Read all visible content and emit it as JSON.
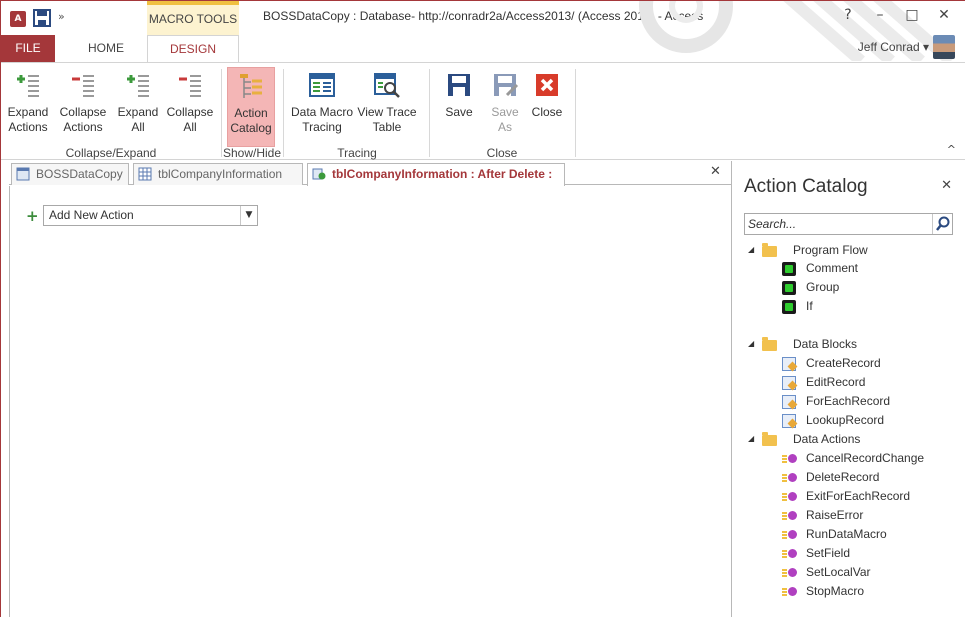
{
  "app": {
    "app_icon_letters": "A",
    "context_tab": "MACRO TOOLS",
    "window_title": "BOSSDataCopy : Database- http://conradr2a/Access2013/ (Access 2013) - Access",
    "window_controls": [
      "?",
      "–",
      "□",
      "✕"
    ],
    "user_name": "Jeff Conrad",
    "user_caret": "▾",
    "qat_more": "»"
  },
  "ribbon_tabs": {
    "file": "FILE",
    "home": "HOME",
    "design": "DESIGN"
  },
  "ribbon": {
    "groups": {
      "collapse_expand": "Collapse/Expand",
      "show_hide": "Show/Hide",
      "tracing": "Tracing",
      "close": "Close"
    },
    "buttons": {
      "expand_actions_1": "Expand",
      "expand_actions_2": "Actions",
      "collapse_actions_1": "Collapse",
      "collapse_actions_2": "Actions",
      "expand_all_1": "Expand",
      "expand_all_2": "All",
      "collapse_all_1": "Collapse",
      "collapse_all_2": "All",
      "action_catalog_1": "Action",
      "action_catalog_2": "Catalog",
      "data_macro_tracing_1": "Data Macro",
      "data_macro_tracing_2": "Tracing",
      "view_trace_table_1": "View Trace",
      "view_trace_table_2": "Table",
      "save": "Save",
      "save_as_1": "Save",
      "save_as_2": "As",
      "close": "Close"
    },
    "collapse_caret": "^"
  },
  "document_tabs": [
    {
      "label": "BOSSDataCopy"
    },
    {
      "label": "tblCompanyInformation"
    },
    {
      "label": "tblCompanyInformation : After Delete :"
    }
  ],
  "doc_close": "✕",
  "editor": {
    "add_new_action": "Add New Action",
    "add_icon": "+",
    "dropdown_caret": "▼"
  },
  "catalog": {
    "title": "Action Catalog",
    "close": "✕",
    "search_placeholder": "Search...",
    "expander": "◢",
    "groups": [
      {
        "name": "Program Flow",
        "items": [
          "Comment",
          "Group",
          "If"
        ]
      },
      {
        "name": "Data Blocks",
        "items": [
          "CreateRecord",
          "EditRecord",
          "ForEachRecord",
          "LookupRecord"
        ]
      },
      {
        "name": "Data Actions",
        "items": [
          "CancelRecordChange",
          "DeleteRecord",
          "ExitForEachRecord",
          "RaiseError",
          "RunDataMacro",
          "SetField",
          "SetLocalVar",
          "StopMacro"
        ]
      }
    ]
  },
  "colors": {
    "accent": "#a4373a",
    "macro_tools": "#fdf3d0",
    "active_button": "#f4b6b6"
  }
}
